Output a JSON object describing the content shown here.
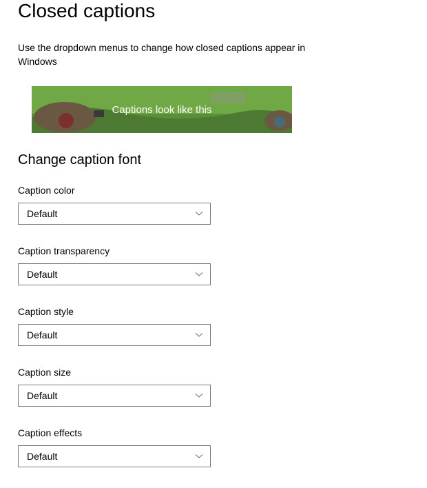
{
  "title": "Closed captions",
  "description": "Use the dropdown menus to change how closed captions appear in Windows",
  "preview_text": "Captions look like this",
  "section_title": "Change caption font",
  "fields": {
    "color": {
      "label": "Caption color",
      "value": "Default"
    },
    "transparency": {
      "label": "Caption transparency",
      "value": "Default"
    },
    "style": {
      "label": "Caption style",
      "value": "Default"
    },
    "size": {
      "label": "Caption size",
      "value": "Default"
    },
    "effects": {
      "label": "Caption effects",
      "value": "Default"
    }
  }
}
